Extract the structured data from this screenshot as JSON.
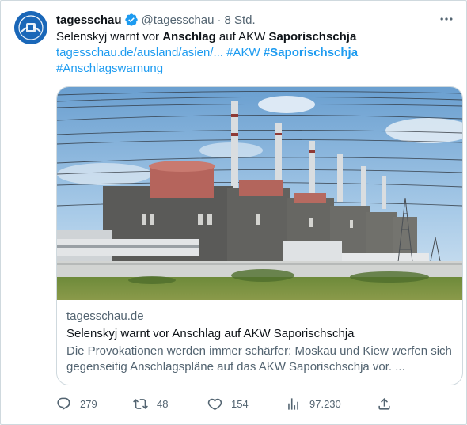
{
  "tweet": {
    "author": {
      "name": "tagesschau",
      "handle": "@tagesschau",
      "separator": "·",
      "time": "8 Std.",
      "verified": true
    },
    "text": {
      "w1": "Selenskyj warnt vor ",
      "w2": "Anschlag",
      "w3": " auf AKW ",
      "w4": "Saporischschja",
      "url": "tagesschau.de/ausland/asien/...",
      "tag1": "#AKW",
      "tag2": "#Saporischschja",
      "tag3": "#Anschlagswarnung"
    },
    "card": {
      "domain": "tagesschau.de",
      "title": "Selenskyj warnt vor Anschlag auf AKW Saporischschja",
      "description": "Die Provokationen werden immer schärfer: Moskau und Kiew werfen sich gegenseitig Anschlagspläne auf das AKW Saporischschja vor. ..."
    },
    "actions": {
      "replies": "279",
      "retweets": "48",
      "likes": "154",
      "views": "97.230"
    }
  },
  "colors": {
    "link": "#1d9bf0",
    "secondary_text": "#536471",
    "primary_text": "#0f1419",
    "border": "#cfd9de",
    "verified_badge": "#1d9bf0",
    "avatar_bg": "#1a67b8"
  },
  "icons": {
    "more": "ellipsis-icon",
    "verified": "verified-badge-icon",
    "reply": "reply-icon",
    "retweet": "retweet-icon",
    "like": "heart-icon",
    "views": "views-chart-icon",
    "share": "share-icon"
  }
}
